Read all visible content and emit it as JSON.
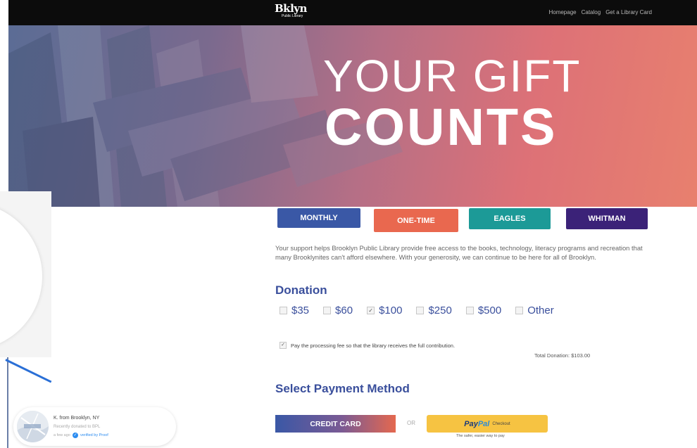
{
  "header": {
    "logo_line1": "Bklyn",
    "logo_line2": "Public Library",
    "nav": [
      "Homepage",
      "Catalog",
      "Get a Library Card"
    ]
  },
  "hero": {
    "title_line1": "YOUR GIFT",
    "title_line2": "COUNTS"
  },
  "tabs": [
    {
      "label": "MONTHLY",
      "color": "#3a58a6"
    },
    {
      "label": "ONE-TIME",
      "color": "#e9684f"
    },
    {
      "label": "EAGLES",
      "color": "#1c9a97"
    },
    {
      "label": "WHITMAN",
      "color": "#3b2278"
    }
  ],
  "intro": "Your support helps Brooklyn Public Library provide free access to the books, technology, literacy programs and recreation that many Brooklynites can't afford elsewhere. With your generosity, we can continue to be here for all of Brooklyn.",
  "donation": {
    "title": "Donation",
    "amounts": [
      {
        "label": "$35",
        "checked": false
      },
      {
        "label": "$60",
        "checked": false
      },
      {
        "label": "$100",
        "checked": true
      },
      {
        "label": "$250",
        "checked": false
      },
      {
        "label": "$500",
        "checked": false
      },
      {
        "label": "Other",
        "checked": false
      }
    ],
    "fee_label": "Pay the processing fee so that the library receives the full contribution.",
    "fee_checked": true,
    "total": "Total Donation: $103.00"
  },
  "payment": {
    "title": "Select Payment Method",
    "credit_card": "CREDIT CARD",
    "or": "OR",
    "paypal_pay": "Pay",
    "paypal_pal": "Pal",
    "paypal_checkout": "Checkout",
    "paypal_tagline": "The safer, easier way to pay"
  },
  "proof": {
    "name": "K. from Brooklyn, NY",
    "action": "Recently donated to BPL",
    "time": "a few ago",
    "verified": "verified by Proof"
  },
  "colors": {
    "accent_blue": "#3a4f9c",
    "accent_coral": "#e9684f",
    "paypal_yellow": "#f6c342"
  }
}
